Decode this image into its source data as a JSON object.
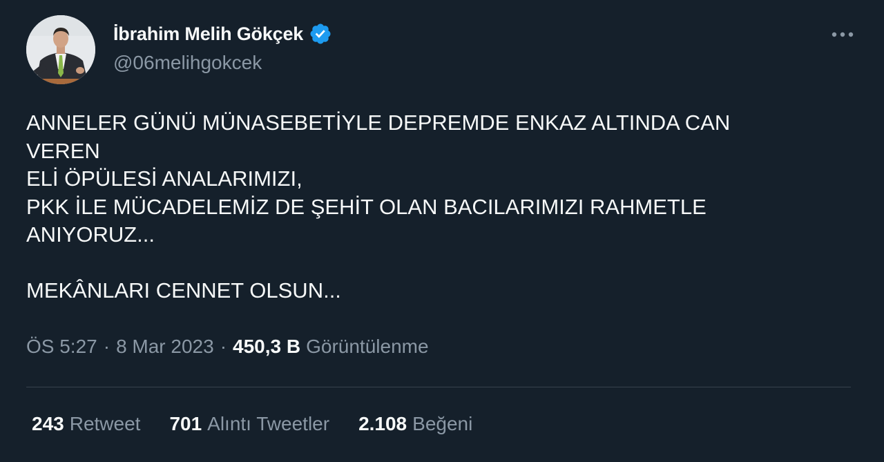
{
  "user": {
    "display_name": "İbrahim Melih Gökçek",
    "handle": "@06melihgokcek",
    "verified": true,
    "verified_color": "#1d9bf0"
  },
  "tweet": {
    "text": "ANNELER GÜNÜ MÜNASEBETİYLE DEPREMDE ENKAZ ALTINDA CAN\nVEREN\nELİ ÖPÜLESİ ANALARIMIZI,\nPKK İLE MÜCADELEMİZ DE ŞEHİT OLAN BACILARIMIZI RAHMETLE\nANIYORUZ...\n\nMEKÂNLARI CENNET OLSUN..."
  },
  "meta": {
    "time": "ÖS 5:27",
    "separator": "·",
    "date": "8 Mar 2023",
    "views_count": "450,3 B",
    "views_label": "Görüntülenme"
  },
  "stats": {
    "retweets_count": "243",
    "retweets_label": "Retweet",
    "quotes_count": "701",
    "quotes_label": "Alıntı Tweetler",
    "likes_count": "2.108",
    "likes_label": "Beğeni"
  },
  "icons": {
    "more": "more-horizontal-icon",
    "verified": "verified-badge-icon"
  },
  "colors": {
    "background": "#15202b",
    "primary_text": "#f7f9f9",
    "secondary_text": "#8b98a5",
    "divider": "#38444d"
  }
}
